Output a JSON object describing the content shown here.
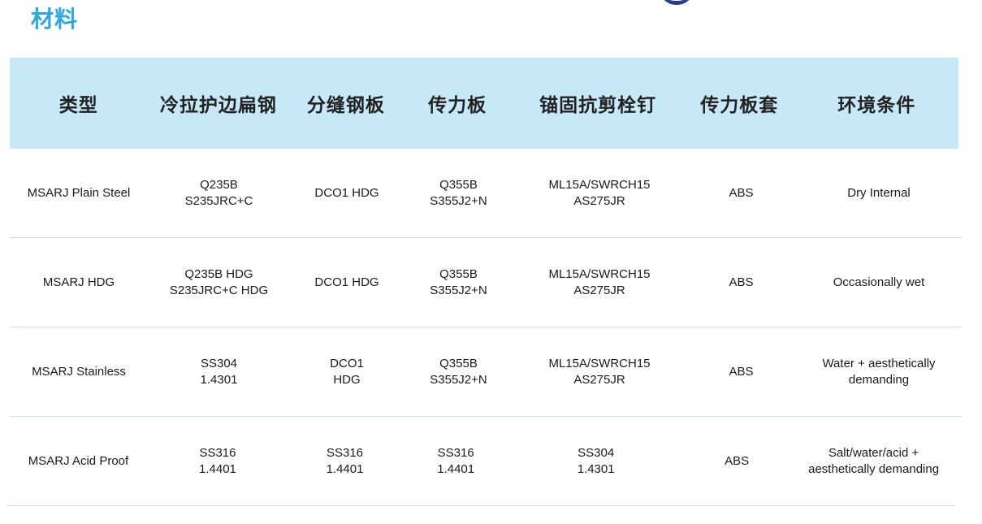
{
  "title": "材料",
  "table": {
    "headers": [
      "类型",
      "冷拉护边扁钢",
      "分缝钢板",
      "传力板",
      "锚固抗剪栓钉",
      "传力板套",
      "环境条件"
    ],
    "rows": [
      {
        "type": [
          "MSARJ Plain Steel"
        ],
        "flat_steel": [
          "Q235B",
          "S235JRC+C"
        ],
        "joint_plate": [
          "DCO1 HDG"
        ],
        "dowel_plate": [
          "Q355B",
          "S355J2+N"
        ],
        "stud": [
          "ML15A/SWRCH15",
          "AS275JR"
        ],
        "sleeve": [
          "ABS"
        ],
        "environment": [
          "Dry Internal"
        ]
      },
      {
        "type": [
          "MSARJ HDG"
        ],
        "flat_steel": [
          "Q235B HDG",
          "S235JRC+C HDG"
        ],
        "joint_plate": [
          "DCO1 HDG"
        ],
        "dowel_plate": [
          "Q355B",
          "S355J2+N"
        ],
        "stud": [
          "ML15A/SWRCH15",
          "AS275JR"
        ],
        "sleeve": [
          "ABS"
        ],
        "environment": [
          "Occasionally wet"
        ]
      },
      {
        "type": [
          "MSARJ Stainless"
        ],
        "flat_steel": [
          "SS304",
          "1.4301"
        ],
        "joint_plate": [
          "DCO1",
          "HDG"
        ],
        "dowel_plate": [
          "Q355B",
          "S355J2+N"
        ],
        "stud": [
          "ML15A/SWRCH15",
          "AS275JR"
        ],
        "sleeve": [
          "ABS"
        ],
        "environment": [
          "Water + aesthetically",
          "demanding"
        ]
      },
      {
        "type": [
          "MSARJ Acid Proof"
        ],
        "flat_steel": [
          "SS316",
          "1.4401"
        ],
        "joint_plate": [
          "SS316",
          "1.4401"
        ],
        "dowel_plate": [
          "SS316",
          "1.4401"
        ],
        "stud": [
          "SS304",
          "1.4301"
        ],
        "sleeve": [
          "ABS"
        ],
        "environment": [
          "Salt/water/acid +",
          "aesthetically demanding"
        ]
      }
    ]
  },
  "colors": {
    "title": "#2ea8de",
    "header_bg": "#c6e8f7",
    "row_divider": "#c9e3ee",
    "logo": "#2a3f8c"
  }
}
